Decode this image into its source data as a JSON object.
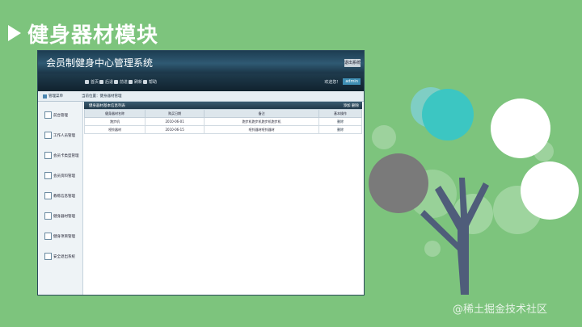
{
  "slide": {
    "title": "健身器材模块"
  },
  "window": {
    "app_title": "会员制健身中心管理系统",
    "logout_label": "退出系统",
    "nav": [
      {
        "label": "首页",
        "icon": "home-icon"
      },
      {
        "label": "后退",
        "icon": "back-icon"
      },
      {
        "label": "前进",
        "icon": "forward-icon"
      },
      {
        "label": "刷新",
        "icon": "refresh-icon"
      },
      {
        "label": "帮助",
        "icon": "help-icon"
      }
    ],
    "user_label": "欢迎您！",
    "user_value": "admin",
    "crumb_left": "管理菜单",
    "crumb_right": "当前位置：健身器材管理",
    "sidebar": [
      {
        "label": "前台管理"
      },
      {
        "label": "工作人员管理"
      },
      {
        "label": "会员卡类型管理"
      },
      {
        "label": "会员资料管理"
      },
      {
        "label": "教练信息管理"
      },
      {
        "label": "健身器材管理"
      },
      {
        "label": "健身项目管理"
      },
      {
        "label": "安全退出系统"
      }
    ],
    "panel_title": "健身器材基本信息列表",
    "panel_actions": "添加  删除",
    "columns": [
      "健身器材名称",
      "购买日期",
      "备注",
      "基本操作"
    ],
    "rows": [
      {
        "name": "跑步机",
        "date": "2010-06-01",
        "note": "跑步机跑步机跑步机跑步机",
        "action": "删除"
      },
      {
        "name": "哑铃器材",
        "date": "2010-06-15",
        "note": "哑铃器材哑铃器材",
        "action": "删除"
      }
    ]
  },
  "watermark": "@稀土掘金技术社区"
}
